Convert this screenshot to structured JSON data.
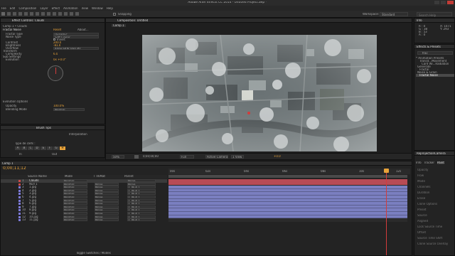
{
  "window": {
    "title": "Adobe After Effects CC 2014 - Untitled Project.aep *"
  },
  "menu": [
    "File",
    "Edit",
    "Composition",
    "Layer",
    "Effect",
    "Animation",
    "View",
    "Window",
    "Help"
  ],
  "toolbar": {
    "snapping": "Snapping",
    "workspace_label": "Workspace:",
    "workspace_value": "Standard",
    "search_placeholder": "Search Help"
  },
  "effect_controls": {
    "tab": "Effect Controls: Clouds",
    "layer_path": "Comp 1 • Clouds",
    "effect_name": "Fractal Noise",
    "reset_label": "Reset",
    "about_label": "About...",
    "props": [
      {
        "name": "Fractal Type",
        "value": "Dynamic"
      },
      {
        "name": "Noise Type",
        "value": "Soft Linear"
      },
      {
        "name": "",
        "value": "Invert"
      },
      {
        "name": "Contrast",
        "value": "200.0"
      },
      {
        "name": "Brightness",
        "value": "-81.0"
      },
      {
        "name": "Overflow",
        "value": "Allow HDR Results"
      },
      {
        "name": "Transform",
        "value": ""
      },
      {
        "name": "Complexity",
        "value": "6.0"
      },
      {
        "name": "Sub Settings",
        "value": ""
      },
      {
        "name": "Evolution",
        "value": "0x +0.0°"
      }
    ],
    "options_label": "Evolution Options",
    "opacity": {
      "name": "Opacity",
      "value": "100.0%"
    },
    "blend": {
      "name": "Blending Mode",
      "value": "Normal"
    }
  },
  "lower_left": {
    "tab": "Brush Tips",
    "type_label": "Type de clefs :",
    "interp_label": "Interpolation",
    "keys": [
      "A",
      "B",
      "C",
      "D",
      "E",
      "F",
      "G",
      "H"
    ],
    "ease_in": "In",
    "ease_out": "Out"
  },
  "composition": {
    "tab": "Composition: Untitled",
    "sub_tab": "Comp 1"
  },
  "viewer_bar": {
    "zoom": "50%",
    "timecode": "0;00;00;00",
    "resolution": "Full",
    "camera": "Active Camera",
    "views": "1 View",
    "exposure": "+0.0"
  },
  "info": {
    "title": "Info",
    "values": [
      "R : 0",
      "G : 38",
      "B : 53",
      "A : 0"
    ],
    "coords": [
      "X: 1071",
      "Y: 293"
    ]
  },
  "effects_presets": {
    "title": "Effects & Presets",
    "search_value": "frac",
    "items": [
      {
        "label": "* Animation Presets",
        "level": 0
      },
      {
        "label": "Transit...Movement",
        "level": 2
      },
      {
        "label": "Card Wi...Radiation",
        "level": 3
      },
      {
        "label": "Generate",
        "level": 1
      },
      {
        "label": "Fractal",
        "level": 2
      },
      {
        "label": "Noise & Grain",
        "level": 1
      },
      {
        "label": "Fractal Noise",
        "level": 2,
        "selected": true
      }
    ]
  },
  "timeline": {
    "comp_tab": "Comp 1",
    "timecode": "0;00;11;12",
    "columns": [
      "Source Name",
      "Mode",
      "T TrkMat",
      "Parent"
    ],
    "ruler": [
      "00s",
      "02s",
      "04s",
      "06s",
      "08s",
      "10s",
      "12s"
    ],
    "toggle_label": "Toggle Switches / Modes",
    "layers": [
      {
        "num": "1",
        "name": "Clouds",
        "mode": "Normal",
        "trk": "",
        "parent": "None",
        "color": "#c74a4a",
        "selected": true
      },
      {
        "num": "2",
        "name": "Null 1",
        "mode": "Normal",
        "trk": "None",
        "parent": "None",
        "color": "#c74a4a"
      },
      {
        "num": "3",
        "name": "1.jpg",
        "mode": "Normal",
        "trk": "None",
        "parent": "2. Null 1",
        "color": "#7c7ad8"
      },
      {
        "num": "4",
        "name": "2.jpg",
        "mode": "Normal",
        "trk": "None",
        "parent": "2. Null 1",
        "color": "#7c7ad8"
      },
      {
        "num": "5",
        "name": "3.jpg",
        "mode": "Normal",
        "trk": "None",
        "parent": "2. Null 1",
        "color": "#7c7ad8"
      },
      {
        "num": "6",
        "name": "4.jpg",
        "mode": "Normal",
        "trk": "None",
        "parent": "2. Null 1",
        "color": "#7c7ad8"
      },
      {
        "num": "7",
        "name": "5.jpg",
        "mode": "Normal",
        "trk": "None",
        "parent": "2. Null 1",
        "color": "#7c7ad8"
      },
      {
        "num": "8",
        "name": "6.jpg",
        "mode": "Normal",
        "trk": "None",
        "parent": "2. Null 1",
        "color": "#7c7ad8"
      },
      {
        "num": "9",
        "name": "7.jpg",
        "mode": "Normal",
        "trk": "None",
        "parent": "2. Null 1",
        "color": "#7c7ad8"
      },
      {
        "num": "10",
        "name": "8.jpg",
        "mode": "Normal",
        "trk": "None",
        "parent": "2. Null 1",
        "color": "#7c7ad8"
      },
      {
        "num": "11",
        "name": "9.jpg",
        "mode": "Normal",
        "trk": "None",
        "parent": "2. Null 1",
        "color": "#7c7ad8"
      },
      {
        "num": "12",
        "name": "10.jpg",
        "mode": "Normal",
        "trk": "None",
        "parent": "2. Null 1",
        "color": "#7c7ad8"
      },
      {
        "num": "13",
        "name": "11.jpg",
        "mode": "Normal",
        "trk": "None",
        "parent": "2. Null 1",
        "color": "#7c7ad8"
      }
    ]
  },
  "right_lower": {
    "title": "ReprojectionCamera",
    "tabs": [
      "Info",
      "Tracker",
      "Paint"
    ],
    "labels": [
      "Opacity",
      "Flow",
      "Mode",
      "Channels",
      "Duration",
      "Erase",
      "Clone Options",
      "Preset",
      "Source",
      "Aligned",
      "Lock Source Time",
      "Offset",
      "Source Time Shift",
      "Clone Source Overlay"
    ]
  },
  "colors": {
    "accent": "#e8a33a",
    "cti": "#d33c3c",
    "layer_bar": "#7a7fc0",
    "clouds_bar": "#b84b55"
  }
}
